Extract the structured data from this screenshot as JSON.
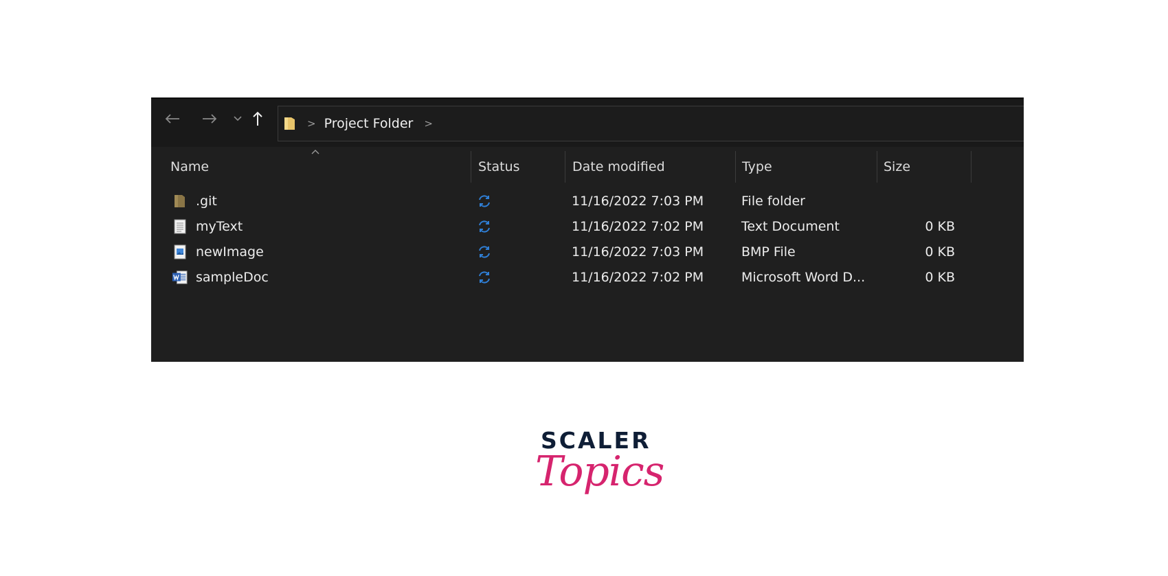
{
  "navigation": {
    "back_icon": "arrow-left-icon",
    "forward_icon": "arrow-right-icon",
    "recent_icon": "chevron-down-icon",
    "up_icon": "arrow-up-icon"
  },
  "address_bar": {
    "folder_icon": "folder-icon",
    "path": [
      "Project Folder"
    ],
    "separator": ">"
  },
  "columns": {
    "name": "Name",
    "status": "Status",
    "date_modified": "Date modified",
    "type": "Type",
    "size": "Size"
  },
  "files": [
    {
      "icon": "folder-icon",
      "name": ".git",
      "status_icon": "sync-icon",
      "date": "11/16/2022 7:03 PM",
      "type": "File folder",
      "size": ""
    },
    {
      "icon": "text-file-icon",
      "name": "myText",
      "status_icon": "sync-icon",
      "date": "11/16/2022 7:02 PM",
      "type": "Text Document",
      "size": "0 KB"
    },
    {
      "icon": "image-file-icon",
      "name": "newImage",
      "status_icon": "sync-icon",
      "date": "11/16/2022 7:03 PM",
      "type": "BMP File",
      "size": "0 KB"
    },
    {
      "icon": "word-file-icon",
      "name": "sampleDoc",
      "status_icon": "sync-icon",
      "date": "11/16/2022 7:02 PM",
      "type": "Microsoft Word D...",
      "size": "0 KB"
    }
  ],
  "logo": {
    "top": "SCALER",
    "bottom": "Topics"
  },
  "colors": {
    "explorer_bg": "#1f1f1f",
    "sync_blue": "#2f7fd6",
    "folder_yellow": "#e8c46a",
    "logo_navy": "#0f1e36",
    "logo_pink": "#d6246e"
  }
}
